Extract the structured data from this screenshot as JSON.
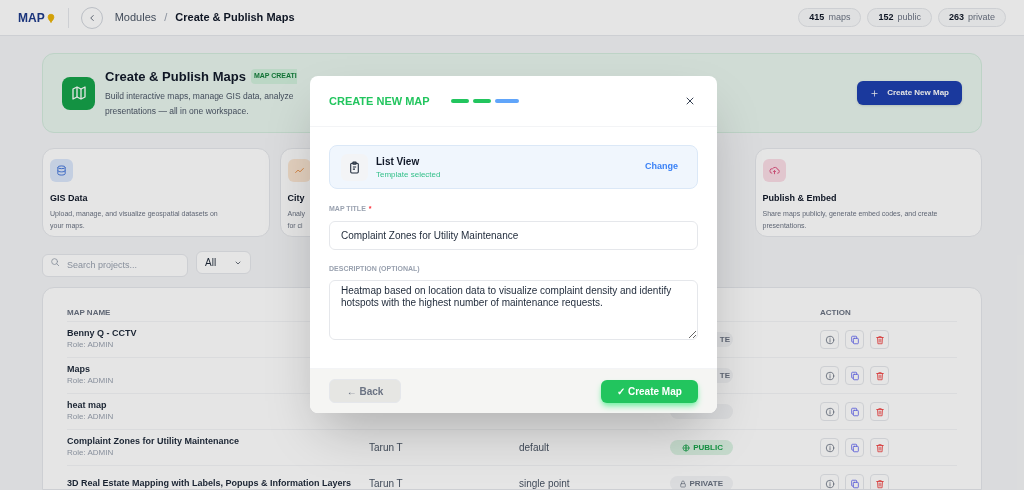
{
  "topbar": {
    "logo": "MAP",
    "breadcrumb": [
      "Modules",
      "Create & Publish Maps"
    ],
    "separator": "/",
    "stats": [
      {
        "value": "415",
        "label": "maps"
      },
      {
        "value": "152",
        "label": "public"
      },
      {
        "value": "263",
        "label": "private"
      }
    ]
  },
  "hero": {
    "title": "Create & Publish Maps",
    "badge": "MAP CREATI",
    "description_lines": [
      "Build interactive maps, manage GIS data, analyze",
      "presentations — all in one workspace."
    ],
    "button": "Create New Map"
  },
  "features": [
    {
      "kind": "gis",
      "title": "GIS Data",
      "description_lines": [
        "Upload, manage, and visualize geospatial datasets on",
        "your maps."
      ]
    },
    {
      "kind": "city",
      "title": "City",
      "description_lines": [
        "Analy",
        "for ci"
      ]
    },
    {
      "kind": "publish",
      "title": "Publish & Embed",
      "description_lines": [
        "Share maps publicly, generate embed codes, and create",
        "presentations."
      ]
    }
  ],
  "search": {
    "placeholder": "Search projects...",
    "filter": "All"
  },
  "table": {
    "columns": [
      "MAP NAME",
      "ACTION"
    ],
    "rows": [
      {
        "name": "Benny Q - CCTV",
        "role": "Role: ADMIN",
        "visibility": {
          "kind": "private",
          "label": "TE"
        }
      },
      {
        "name": "Maps",
        "role": "Role: ADMIN",
        "visibility": {
          "kind": "private",
          "label": "TE"
        }
      },
      {
        "name": "heat map",
        "role": "Role: ADMIN",
        "visibility": {
          "kind": "private"
        }
      },
      {
        "name": "Complaint Zones for Utility Maintenance",
        "role": "Role: ADMIN",
        "owner": "Tarun T",
        "type": "default",
        "visibility": {
          "kind": "public",
          "label": "PUBLIC"
        }
      },
      {
        "name": "3D Real Estate Mapping with Labels, Popups & Information Layers",
        "owner": "Tarun T",
        "type": "single point",
        "visibility": {
          "kind": "private",
          "label": "PRIVATE"
        }
      }
    ]
  },
  "modal": {
    "title": "CREATE NEW MAP",
    "steps": [
      {
        "completed": true
      },
      {
        "completed": true
      },
      {
        "completed": false
      }
    ],
    "template": {
      "name": "List View",
      "status": "Template selected",
      "action": "Change"
    },
    "title_field": {
      "label": "MAP TITLE",
      "required_mark": "*",
      "value": "Complaint Zones for Utility Maintenance"
    },
    "description_field": {
      "label": "DESCRIPTION (OPTIONAL)",
      "value": "Heatmap based on location data to visualize complaint density and identify hotspots with the highest number of maintenance requests."
    },
    "back_button": "← Back",
    "create_button": "✓ Create Map"
  }
}
